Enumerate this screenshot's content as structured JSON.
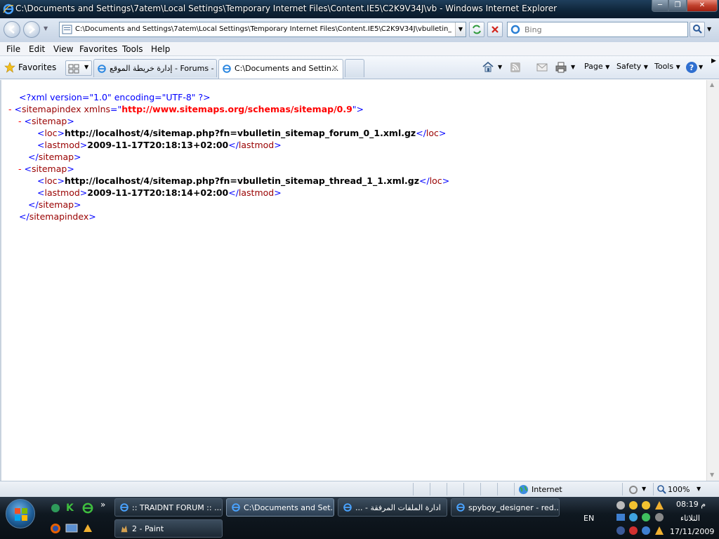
{
  "window": {
    "title": "C:\\Documents and Settings\\7atem\\Local Settings\\Temporary Internet Files\\Content.IE5\\C2K9V34J\\vb - Windows Internet Explorer"
  },
  "address_bar": {
    "url": "C:\\Documents and Settings\\7atem\\Local Settings\\Temporary Internet Files\\Content.IE5\\C2K9V34J\\vbulletin_site",
    "search_placeholder": "Bing"
  },
  "menu": [
    "File",
    "Edit",
    "View",
    "Favorites",
    "Tools",
    "Help"
  ],
  "favorites_bar": {
    "favorites_label": "Favorites",
    "tabs": [
      {
        "label": "إدارة خريطة الموقع - Forums - ...",
        "active": false
      },
      {
        "label": "C:\\Documents and Settin...",
        "active": true
      }
    ],
    "commands": [
      "Page",
      "Safety",
      "Tools"
    ]
  },
  "xml": {
    "declaration": "<?xml version=\"1.0\" encoding=\"UTF-8\" ?>",
    "root_tag": "sitemapindex",
    "root_attr_name": "xmlns",
    "root_attr_value": "http://www.sitemaps.org/schemas/sitemap/0.9",
    "sitemaps": [
      {
        "loc": "http://localhost/4/sitemap.php?fn=vbulletin_sitemap_forum_0_1.xml.gz",
        "lastmod": "2009-11-17T20:18:13+02:00"
      },
      {
        "loc": "http://localhost/4/sitemap.php?fn=vbulletin_sitemap_thread_1_1.xml.gz",
        "lastmod": "2009-11-17T20:18:14+02:00"
      }
    ]
  },
  "status_bar": {
    "zone": "Internet",
    "zoom": "100%"
  },
  "taskbar": {
    "buttons": [
      {
        "label": ":: TRAIDNT FORUM :: ...",
        "active": false
      },
      {
        "label": "C:\\Documents and Set...",
        "active": true
      },
      {
        "label": "... - ادارة الملفات المرفقة",
        "active": false
      },
      {
        "label": "spyboy_designer - red...",
        "active": false
      },
      {
        "label": "2 - Paint",
        "active": false
      }
    ],
    "language": "EN",
    "time": "08:19 م",
    "day": "الثلاثاء",
    "date": "17/11/2009"
  },
  "colors": {
    "xml_tag": "#990000",
    "xml_punct": "#0000ff",
    "xml_minus": "#ff0000",
    "titlebar": "#0e2438"
  }
}
